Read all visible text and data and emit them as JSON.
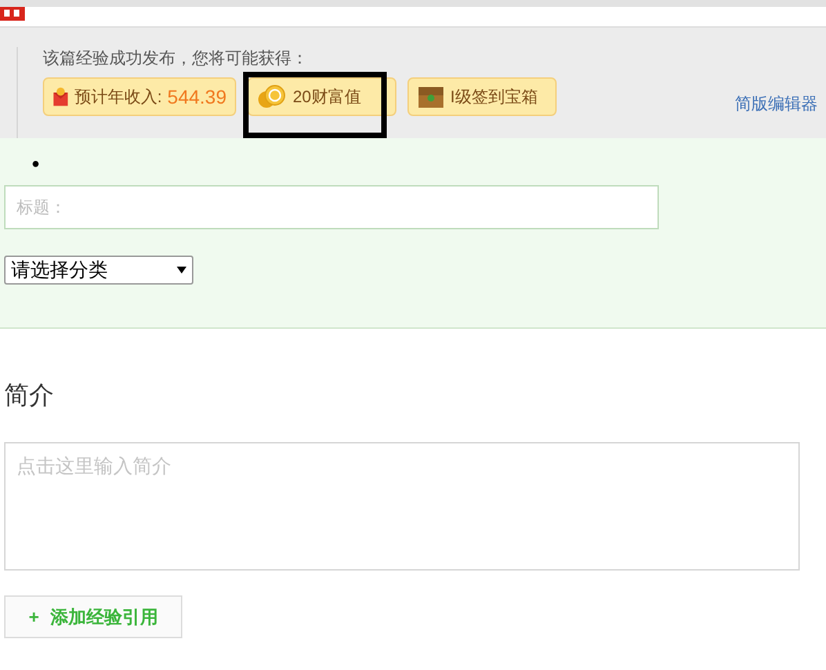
{
  "reward_panel": {
    "message": "该篇经验成功发布，您将可能获得：",
    "rewards": [
      {
        "kind": "income",
        "label": "预计年收入:",
        "value": "544.39",
        "highlighted": false
      },
      {
        "kind": "coin",
        "label": "20财富值",
        "highlighted": true
      },
      {
        "kind": "chest",
        "label": "I级签到宝箱",
        "highlighted": false
      }
    ],
    "editor_link": "简版编辑器"
  },
  "form": {
    "bullet": "•",
    "title_field": {
      "placeholder": "标题："
    },
    "category_select": {
      "value": "请选择分类"
    }
  },
  "intro": {
    "heading": "简介",
    "field": {
      "placeholder": "点击这里输入简介"
    },
    "add_button": {
      "icon": "+",
      "label": "添加经验引用"
    }
  }
}
